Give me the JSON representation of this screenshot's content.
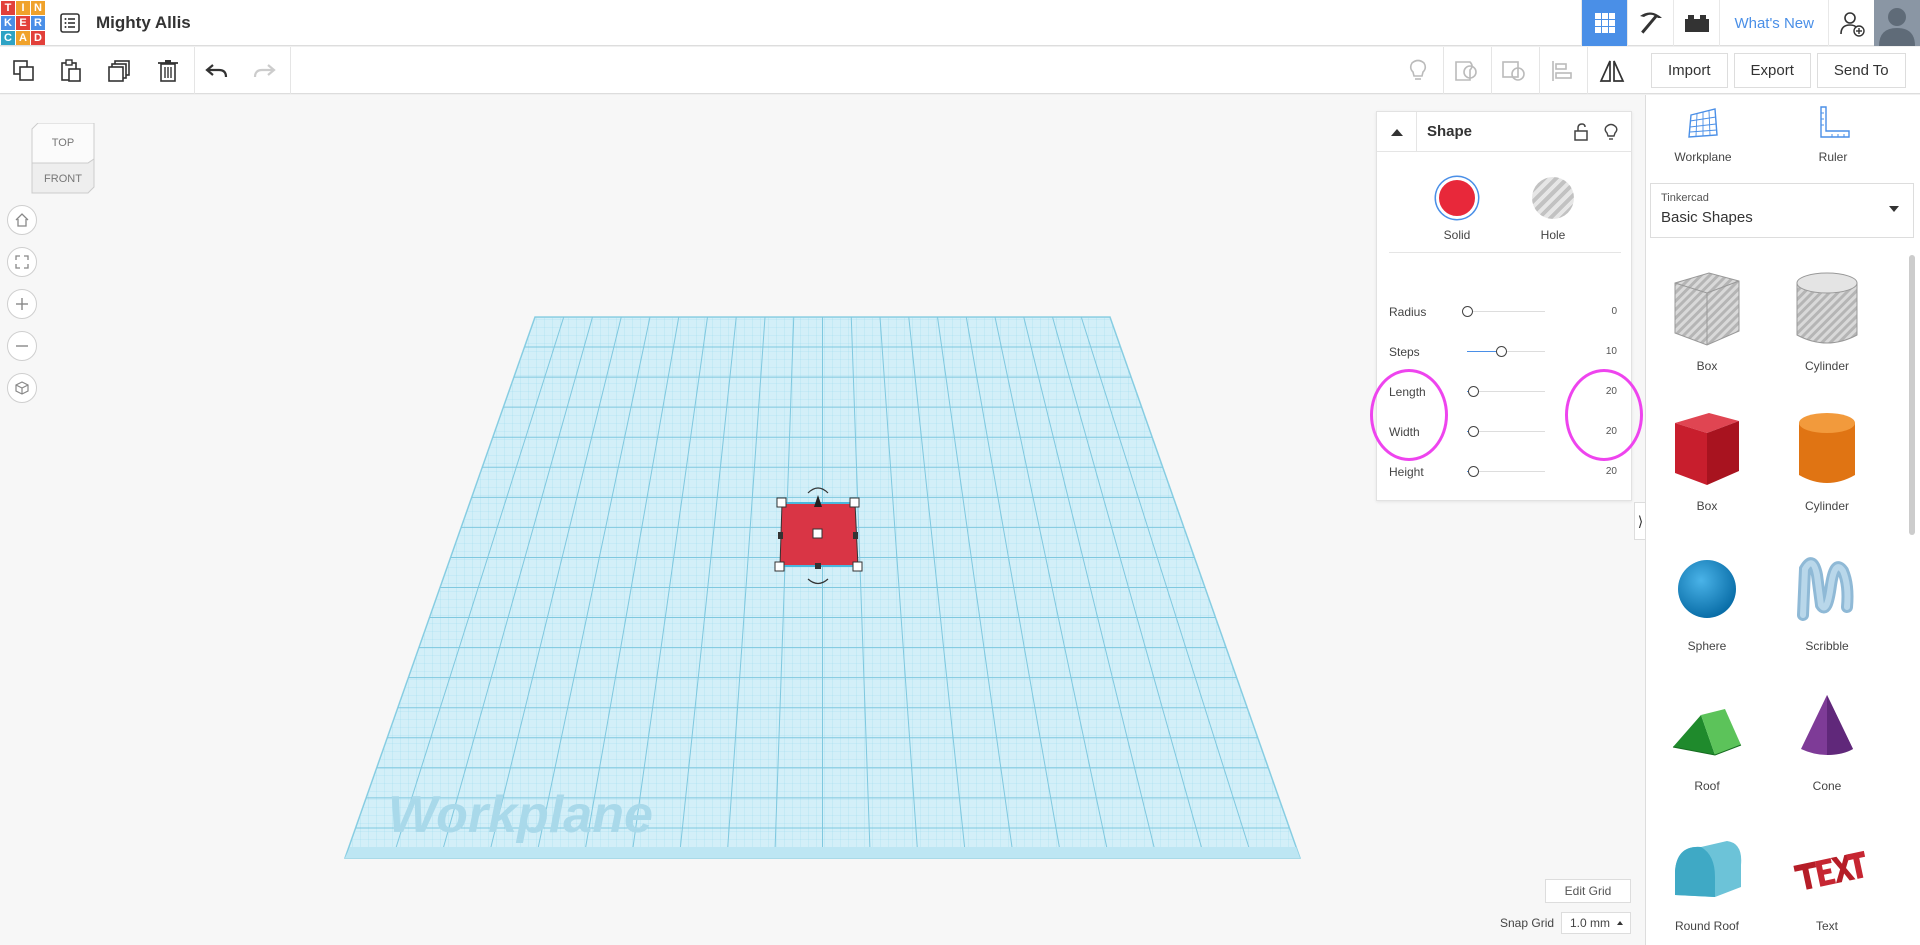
{
  "header": {
    "logo_letters": [
      "T",
      "I",
      "N",
      "K",
      "E",
      "R",
      "C",
      "A",
      "D"
    ],
    "logo_colors": [
      "#e2403a",
      "#f0a22b",
      "#f0a22b",
      "#4a8fe7",
      "#e2403a",
      "#4a8fe7",
      "#2ea3c5",
      "#f0a22b",
      "#e2403a"
    ],
    "project_title": "Mighty Allis",
    "whats_new": "What's New"
  },
  "actions": {
    "import": "Import",
    "export": "Export",
    "send_to": "Send To"
  },
  "viewcube": {
    "top": "TOP",
    "front": "FRONT"
  },
  "workplane_label": "Workplane",
  "inspector": {
    "title": "Shape",
    "solid_label": "Solid",
    "hole_label": "Hole",
    "solid_color": "#e8283a",
    "properties": [
      {
        "label": "Radius",
        "value": "0",
        "level": 0
      },
      {
        "label": "Steps",
        "value": "10",
        "level": 0.44
      },
      {
        "label": "Length",
        "value": "20",
        "level": 0.08
      },
      {
        "label": "Width",
        "value": "20",
        "level": 0.08
      },
      {
        "label": "Height",
        "value": "20",
        "level": 0.08
      }
    ]
  },
  "right_panel": {
    "workplane": "Workplane",
    "ruler": "Ruler",
    "library_small": "Tinkercad",
    "library_main": "Basic Shapes",
    "shapes": [
      {
        "label": "Box",
        "icon": "box-hole-icon"
      },
      {
        "label": "Cylinder",
        "icon": "cylinder-hole-icon"
      },
      {
        "label": "Box",
        "icon": "box-icon"
      },
      {
        "label": "Cylinder",
        "icon": "cylinder-icon"
      },
      {
        "label": "Sphere",
        "icon": "sphere-icon"
      },
      {
        "label": "Scribble",
        "icon": "scribble-icon"
      },
      {
        "label": "Roof",
        "icon": "roof-icon"
      },
      {
        "label": "Cone",
        "icon": "cone-icon"
      },
      {
        "label": "Round Roof",
        "icon": "round-roof-icon"
      },
      {
        "label": "Text",
        "icon": "text-shape-icon"
      }
    ]
  },
  "bottom": {
    "edit_grid": "Edit Grid",
    "snap_grid_label": "Snap Grid",
    "snap_grid_value": "1.0 mm"
  },
  "colors": {
    "accent": "#4a8fe7",
    "grid": "#7fd0e6",
    "annotation": "#ee44ee"
  }
}
